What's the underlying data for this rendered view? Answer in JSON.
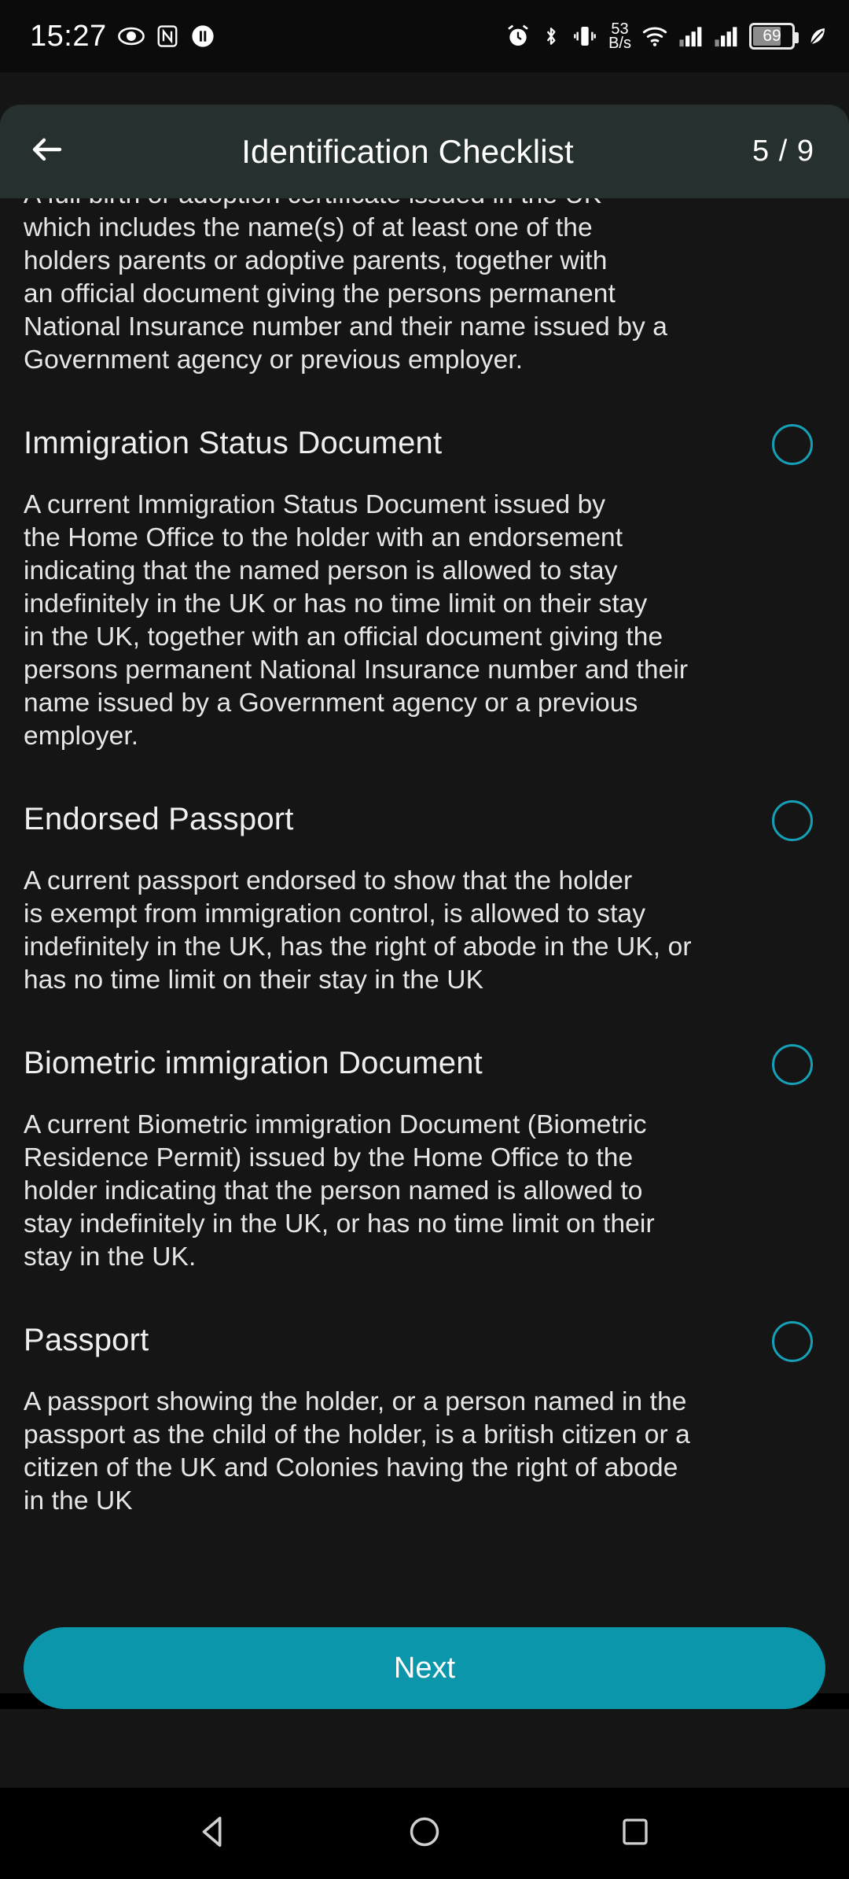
{
  "status_bar": {
    "time": "15:27",
    "left_icons": [
      "eye-icon",
      "nfc-icon",
      "pause-icon"
    ],
    "network_speed_value": "53",
    "network_speed_unit": "B/s",
    "right_icons": [
      "alarm-icon",
      "bluetooth-icon",
      "vibrate-icon",
      "wifi-icon",
      "signal-sim1-icon",
      "signal-sim2-icon"
    ],
    "battery_percent": "69",
    "power_saving_icon": "leaf-icon"
  },
  "app_bar": {
    "back_icon": "arrow-left-icon",
    "title": "Identification Checklist",
    "step_counter": "5 / 9"
  },
  "colors": {
    "accent": "#0b96ac",
    "radio_outline": "#15a0b8",
    "app_bar_bg": "#26302e",
    "page_bg": "#151515"
  },
  "content": {
    "clipped_paragraph": "A full birth or adoption certificate issued in the UK\nwhich includes the name(s) of at least one of the\nholders parents or adoptive parents, together with\nan official document giving the persons permanent\nNational Insurance number and their name issued by a\nGovernment agency or previous employer.",
    "items": [
      {
        "title": "Immigration Status Document",
        "selected": false,
        "description": "A current Immigration Status Document issued by\nthe Home Office to the holder with an endorsement\nindicating that the named person is allowed to stay\nindefinitely in the UK or has no time limit on their stay\nin the UK, together with an official document giving the\npersons permanent National Insurance number and their\nname issued by a Government agency or a previous\nemployer."
      },
      {
        "title": "Endorsed Passport",
        "selected": false,
        "description": "A current passport endorsed to show that the holder\nis exempt from immigration control, is allowed to stay\nindefinitely in the UK, has the right of abode in the UK, or\nhas no time limit on their stay in the UK"
      },
      {
        "title": "Biometric immigration Document",
        "selected": false,
        "description": "A current Biometric immigration Document (Biometric\nResidence Permit) issued by the Home Office to the\nholder indicating that the person named is allowed to\nstay indefinitely in the UK, or has no time limit on their\nstay in the UK."
      },
      {
        "title": "Passport",
        "selected": false,
        "description": "A passport showing the holder, or a person named in the\npassport as the child of the holder, is a british citizen or a\ncitizen of the UK and Colonies having the right of abode\nin the UK"
      }
    ]
  },
  "footer": {
    "next_label": "Next"
  },
  "nav_bar": {
    "back_icon": "triangle-back-icon",
    "home_icon": "circle-home-icon",
    "recents_icon": "square-recents-icon"
  }
}
